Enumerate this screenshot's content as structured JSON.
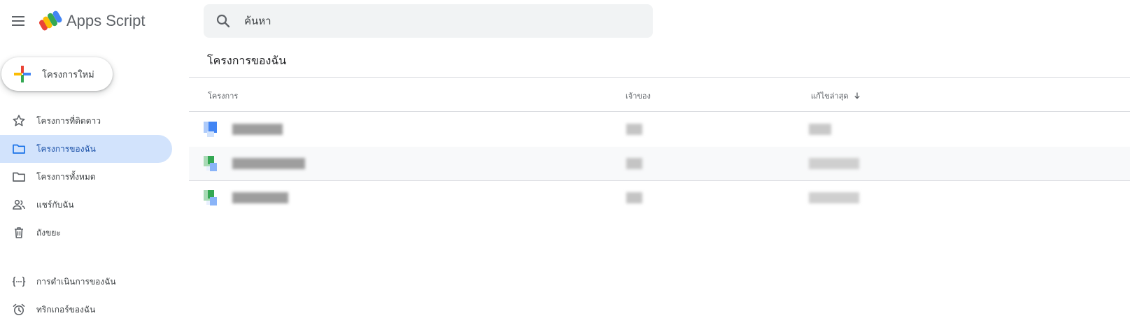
{
  "app": {
    "title": "Apps Script",
    "accent": "#1a73e8",
    "active_nav_bg": "#d2e3fc"
  },
  "search": {
    "placeholder": "ค้นหา",
    "value": "",
    "icon": "search-icon"
  },
  "new_project": {
    "label": "โครงการใหม่",
    "icon": "colored-plus-icon"
  },
  "sidebar": {
    "items": [
      {
        "label": "โครงการที่ติดดาว",
        "icon": "star-icon",
        "active": false
      },
      {
        "label": "โครงการของฉัน",
        "icon": "folder-icon",
        "active": true
      },
      {
        "label": "โครงการทั้งหมด",
        "icon": "folder-icon",
        "active": false
      },
      {
        "label": "แชร์กับฉัน",
        "icon": "people-icon",
        "active": false
      },
      {
        "label": "ถังขยะ",
        "icon": "trash-icon",
        "active": false
      }
    ],
    "secondary_items": [
      {
        "label": "การดำเนินการของฉัน",
        "icon": "executions-icon"
      },
      {
        "label": "ทริกเกอร์ของฉัน",
        "icon": "alarm-clock-icon"
      }
    ]
  },
  "main": {
    "title": "โครงการของฉัน",
    "columns": [
      {
        "label": "โครงการ"
      },
      {
        "label": "เจ้าของ"
      },
      {
        "label": "แก้ไขล่าสุด",
        "sort": "descending"
      }
    ],
    "rows": [
      {
        "icon": "standalone-script-icon",
        "name": "",
        "owner": "",
        "modified": "",
        "redacted": true
      },
      {
        "icon": "sheets-bound-script-icon",
        "name": "",
        "owner": "",
        "modified": "",
        "redacted": true
      },
      {
        "icon": "sheets-bound-script-icon",
        "name": "",
        "owner": "",
        "modified": "",
        "redacted": true
      }
    ]
  }
}
